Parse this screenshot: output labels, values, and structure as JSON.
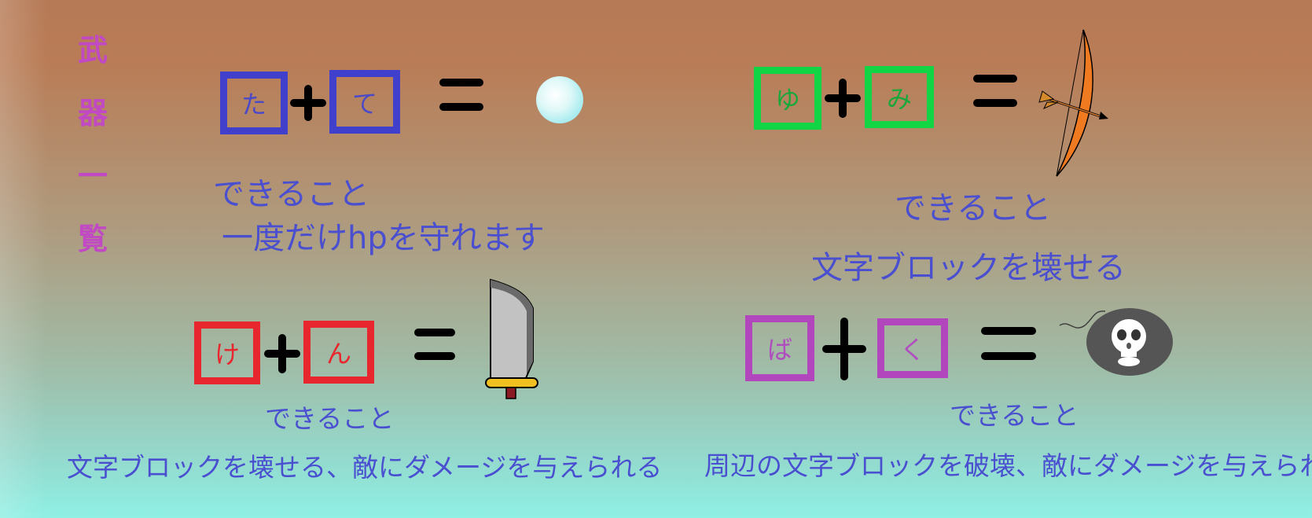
{
  "title_chars": [
    "武",
    "器",
    "一",
    "覧"
  ],
  "weapons": {
    "shield": {
      "char1": "た",
      "char2": "て",
      "ability_label": "できること",
      "ability": "一度だけhpを守れます",
      "icon": "bubble-shield-icon",
      "color": "#4040cc"
    },
    "bow": {
      "char1": "ゆ",
      "char2": "み",
      "ability_label": "できること",
      "ability": "文字ブロックを壊せる",
      "icon": "bow-arrow-icon",
      "color": "#11d544"
    },
    "sword": {
      "char1": "け",
      "char2": "ん",
      "ability_label": "できること",
      "ability": "文字ブロックを壊せる、敵にダメージを与えられる",
      "icon": "sword-icon",
      "color": "#e8262e"
    },
    "bomb": {
      "char1": "ば",
      "char2": "く",
      "ability_label": "できること",
      "ability": "周辺の文字ブロックを破壊、敵にダメージを与えられる",
      "icon": "skull-bomb-icon",
      "color": "#b246bd"
    }
  }
}
